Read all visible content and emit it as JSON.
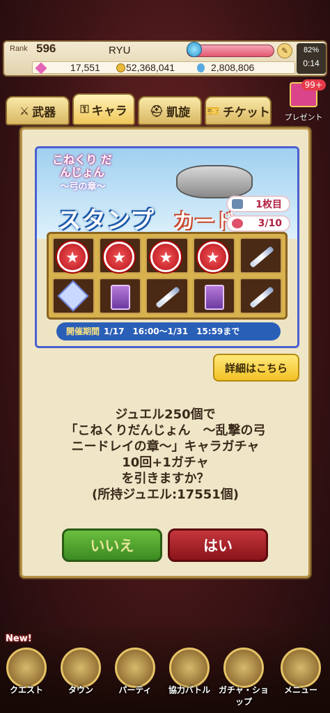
{
  "status": {
    "rank_label": "Rank",
    "rank": "596",
    "player": "RYU",
    "gems": "17,551",
    "coins": "52,368,041",
    "drops": "2,808,806",
    "battery": "82%",
    "time": "0:14"
  },
  "tabs": [
    {
      "label": "武器"
    },
    {
      "label": "キャラ"
    },
    {
      "label": "凱旋"
    },
    {
      "label": "チケット"
    }
  ],
  "present": {
    "label": "プレゼント",
    "count": "99+"
  },
  "banner": {
    "logo_title": "こねくり だんじょん",
    "logo_sub": "〜弓の章〜",
    "title_a": "スタンプ",
    "title_b": "カード",
    "sheet_count": "1枚目",
    "progress": "3/10",
    "period_label": "開催期間",
    "period_value": "1/17　16:00〜1/31　15:59まで"
  },
  "detail_button": "詳細はこちら",
  "message": {
    "line1": "ジュエル250個で",
    "line2": "「こねくりだんじょん　〜乱撃の弓",
    "line3": "ニードレイの章〜」キャラガチャ",
    "line4": "10回+1ガチャ",
    "line5": "を引きますか？",
    "line6": "(所持ジュエル:17551個)"
  },
  "buttons": {
    "no": "いいえ",
    "yes": "はい"
  },
  "nav": [
    {
      "label": "クエスト"
    },
    {
      "label": "タウン"
    },
    {
      "label": "パーティ"
    },
    {
      "label": "協力バトル"
    },
    {
      "label": "ガチャ・ショップ"
    },
    {
      "label": "メニュー"
    }
  ],
  "nav_badges": {
    "new": "New!"
  }
}
